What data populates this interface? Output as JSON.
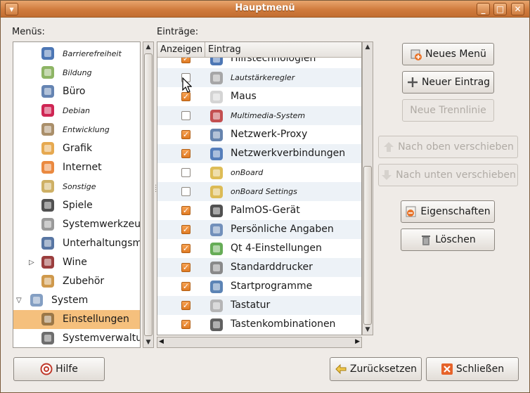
{
  "window": {
    "title": "Hauptmenü"
  },
  "labels": {
    "menus": "Menüs:",
    "entries": "Einträge:"
  },
  "columns": {
    "show": "Anzeigen",
    "entry": "Eintrag"
  },
  "menus": [
    {
      "label": "Barrierefreiheit",
      "italic": true,
      "icon": "accessibility-icon",
      "indent": 1
    },
    {
      "label": "Bildung",
      "italic": true,
      "icon": "education-icon",
      "indent": 1
    },
    {
      "label": "Büro",
      "italic": false,
      "icon": "office-icon",
      "indent": 1
    },
    {
      "label": "Debian",
      "italic": true,
      "icon": "debian-icon",
      "indent": 1
    },
    {
      "label": "Entwicklung",
      "italic": true,
      "icon": "development-icon",
      "indent": 1
    },
    {
      "label": "Grafik",
      "italic": false,
      "icon": "graphics-icon",
      "indent": 1
    },
    {
      "label": "Internet",
      "italic": false,
      "icon": "internet-icon",
      "indent": 1
    },
    {
      "label": "Sonstige",
      "italic": true,
      "icon": "other-icon",
      "indent": 1
    },
    {
      "label": "Spiele",
      "italic": false,
      "icon": "games-icon",
      "indent": 1
    },
    {
      "label": "Systemwerkzeuge",
      "italic": false,
      "icon": "system-tools-icon",
      "indent": 1
    },
    {
      "label": "Unterhaltungsmedien",
      "italic": false,
      "icon": "multimedia-icon",
      "indent": 1
    },
    {
      "label": "Wine",
      "italic": false,
      "icon": "wine-icon",
      "indent": 1,
      "expander": "collapsed"
    },
    {
      "label": "Zubehör",
      "italic": false,
      "icon": "accessories-icon",
      "indent": 1
    },
    {
      "label": "System",
      "italic": false,
      "icon": "system-icon",
      "indent": 0,
      "expander": "expanded"
    },
    {
      "label": "Einstellungen",
      "italic": false,
      "icon": "preferences-icon",
      "indent": 1,
      "selected": true
    },
    {
      "label": "Systemverwaltung",
      "italic": false,
      "icon": "administration-icon",
      "indent": 1
    }
  ],
  "entries": [
    {
      "label": "Hilfstechnologien",
      "italic": false,
      "checked": true,
      "icon": "assistive-tech-icon"
    },
    {
      "label": "Lautstärkeregler",
      "italic": true,
      "checked": false,
      "icon": "volume-icon"
    },
    {
      "label": "Maus",
      "italic": false,
      "checked": true,
      "icon": "mouse-icon"
    },
    {
      "label": "Multimedia-System",
      "italic": true,
      "checked": false,
      "icon": "multimedia-system-icon"
    },
    {
      "label": "Netzwerk-Proxy",
      "italic": false,
      "checked": true,
      "icon": "network-proxy-icon"
    },
    {
      "label": "Netzwerkverbindungen",
      "italic": false,
      "checked": true,
      "icon": "network-connections-icon"
    },
    {
      "label": "onBoard",
      "italic": true,
      "checked": false,
      "icon": "onboard-icon"
    },
    {
      "label": "onBoard Settings",
      "italic": true,
      "checked": false,
      "icon": "onboard-settings-icon"
    },
    {
      "label": "PalmOS-Gerät",
      "italic": false,
      "checked": true,
      "icon": "palm-device-icon"
    },
    {
      "label": "Persönliche Angaben",
      "italic": false,
      "checked": true,
      "icon": "personal-info-icon"
    },
    {
      "label": "Qt 4-Einstellungen",
      "italic": false,
      "checked": true,
      "icon": "qt-settings-icon"
    },
    {
      "label": "Standarddrucker",
      "italic": false,
      "checked": true,
      "icon": "printer-icon"
    },
    {
      "label": "Startprogramme",
      "italic": false,
      "checked": true,
      "icon": "startup-icon"
    },
    {
      "label": "Tastatur",
      "italic": false,
      "checked": true,
      "icon": "keyboard-icon"
    },
    {
      "label": "Tastenkombinationen",
      "italic": false,
      "checked": true,
      "icon": "shortcuts-icon"
    }
  ],
  "buttons": {
    "new_menu": "Neues Menü",
    "new_entry": "Neuer Eintrag",
    "new_separator": "Neue Trennlinie",
    "move_up": "Nach oben verschieben",
    "move_down": "Nach unten verschieben",
    "properties": "Eigenschaften",
    "delete": "Löschen",
    "help": "Hilfe",
    "revert": "Zurücksetzen",
    "close": "Schließen"
  },
  "colors": {
    "titlebar": "#d07b3d",
    "selection": "#f5c07d",
    "checked": "#e07b24"
  }
}
